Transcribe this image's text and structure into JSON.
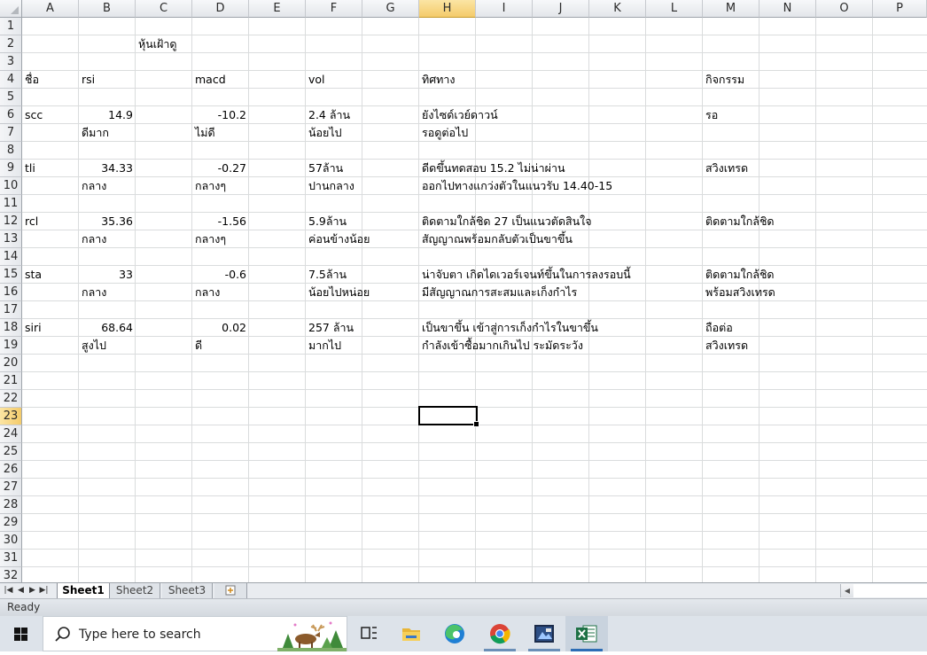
{
  "columns": [
    "A",
    "B",
    "C",
    "D",
    "E",
    "F",
    "G",
    "H",
    "I",
    "J",
    "K",
    "L",
    "M",
    "N",
    "O",
    "P"
  ],
  "rows": [
    "1",
    "2",
    "3",
    "4",
    "5",
    "6",
    "7",
    "8",
    "9",
    "10",
    "11",
    "12",
    "13",
    "14",
    "15",
    "16",
    "17",
    "18",
    "19",
    "20",
    "21",
    "22",
    "23",
    "24",
    "25",
    "26",
    "27",
    "28",
    "29",
    "30",
    "31",
    "32"
  ],
  "selected_col": "H",
  "selected_row": "23",
  "cells": {
    "C2": "หุ้นเฝ้าดู",
    "A4": "ชื่อ",
    "B4": "rsi",
    "D4": "macd",
    "F4": "vol",
    "H4": "ทิศทาง",
    "M4": "กิจกรรม",
    "A6": "scc",
    "B6": "14.9",
    "D6": "-10.2",
    "F6": "2.4 ล้าน",
    "H6": "ยังไซด์เวย์ดาวน์",
    "M6": "รอ",
    "B7": "ดีมาก",
    "D7": "ไม่ดี",
    "F7": "น้อยไป",
    "H7": "รอดูต่อไป",
    "A9": "tli",
    "B9": "34.33",
    "D9": "-0.27",
    "F9": "57ล้าน",
    "H9": "ดีดขึ้นทดสอบ 15.2  ไม่น่าผ่าน",
    "M9": "สวิงเทรด",
    "B10": "กลาง",
    "D10": "กลางๆ",
    "F10": "ปานกลาง",
    "H10": "ออกไปทางแกว่งตัวในแนวรับ 14.40-15",
    "A12": "rcl",
    "B12": "35.36",
    "D12": "-1.56",
    "F12": "5.9ล้าน",
    "H12": "ติดตามใกล้ชิด  27 เป็นแนวตัดสินใจ",
    "M12": "ติดตามใกล้ชิด",
    "B13": "กลาง",
    "D13": "กลางๆ",
    "F13": "ค่อนข้างน้อย",
    "H13": "สัญญาณพร้อมกลับตัวเป็นขาขึ้น",
    "A15": "sta",
    "B15": "33",
    "D15": "-0.6",
    "F15": "7.5ล้าน",
    "H15": "น่าจับตา  เกิดไดเวอร์เจนท์ขึ้นในการลงรอบนี้",
    "M15": "ติดตามใกล้ชิด",
    "B16": "กลาง",
    "D16": "กลาง",
    "F16": "น้อยไปหน่อย",
    "H16": "มีสัญญาณการสะสมและเก็งกำไร",
    "M16": "พร้อมสวิงเทรด",
    "A18": "siri",
    "B18": "68.64",
    "D18": "0.02",
    "F18": "257 ล้าน",
    "H18": "เป็นขาขึ้น เข้าสู่การเก็งกำไรในขาขึ้น",
    "M18": "ถือต่อ",
    "B19": "สูงไป",
    "D19": "ดี",
    "F19": "มากไป",
    "H19": "กำลังเข้าซื้อมากเกินไป  ระมัดระวัง",
    "M19": "สวิงเทรด"
  },
  "numeric_cells": [
    "B6",
    "D6",
    "B9",
    "D9",
    "B12",
    "D12",
    "B15",
    "D15",
    "B18",
    "D18"
  ],
  "sheet_tabs": [
    "Sheet1",
    "Sheet2",
    "Sheet3"
  ],
  "active_sheet": "Sheet1",
  "status": "Ready",
  "taskbar": {
    "search_placeholder": "Type here to search"
  }
}
